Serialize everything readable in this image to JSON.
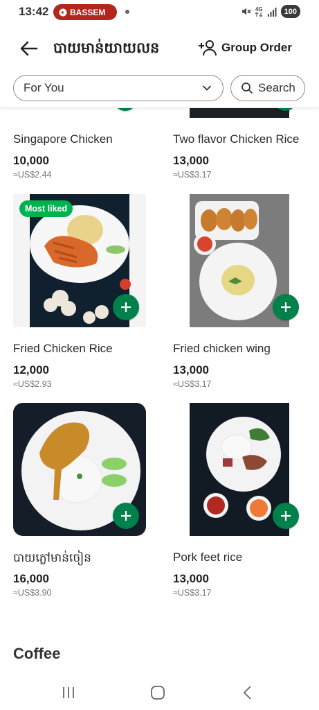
{
  "status_bar": {
    "time": "13:42",
    "call_label": "BASSEM",
    "network": "4G",
    "battery": "100"
  },
  "header": {
    "title": "បាយមាន់យាយលន",
    "group_order_label": "Group Order"
  },
  "filters": {
    "category": "For You",
    "search_label": "Search"
  },
  "items": [
    {
      "name": "Singapore Chicken",
      "price": "10,000",
      "usd": "≈US$2.44"
    },
    {
      "name": "Two flavor Chicken Rice",
      "price": "13,000",
      "usd": "≈US$3.17"
    },
    {
      "name": "Fried Chicken Rice",
      "price": "12,000",
      "usd": "≈US$2.93",
      "badge": "Most liked"
    },
    {
      "name": "Fried chicken wing",
      "price": "13,000",
      "usd": "≈US$3.17"
    },
    {
      "name": "បាយភ្លៅមាន់ចៀន",
      "price": "16,000",
      "usd": "≈US$3.90"
    },
    {
      "name": "Pork feet rice",
      "price": "13,000",
      "usd": "≈US$3.17"
    }
  ],
  "next_section_title": "Coffee",
  "colors": {
    "brand_green": "#00b14f",
    "add_button_green": "#00804a",
    "call_pill_red": "#b3261e"
  }
}
